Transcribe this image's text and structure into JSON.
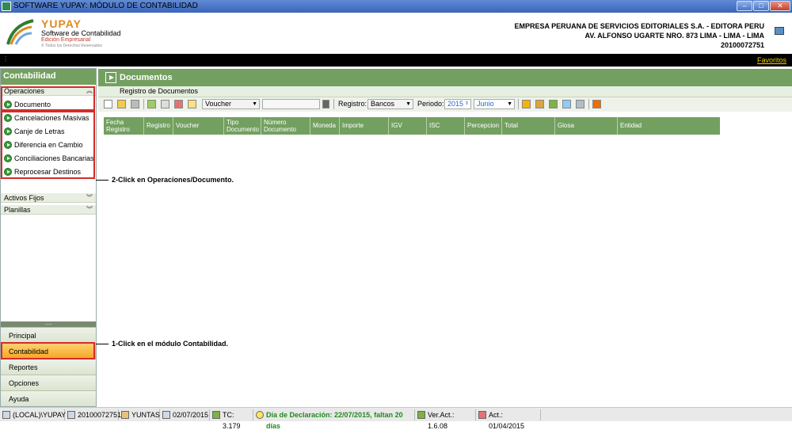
{
  "window": {
    "title": "SOFTWARE YUPAY: MÓDULO DE CONTABILIDAD"
  },
  "brand": {
    "name": "YUPAY",
    "subtitle": "Software de Contabilidad",
    "edition": "Edición Empresarial",
    "copyright": "© Todos los Derechos Reservados"
  },
  "company": {
    "name": "EMPRESA PERUANA DE SERVICIOS EDITORIALES S.A. - EDITORA PERU",
    "address": "AV. ALFONSO UGARTE NRO. 873 LIMA - LIMA - LIMA",
    "ruc": "20100072751"
  },
  "topbar": {
    "favoritos": "Favoritos"
  },
  "sidebar": {
    "title": "Contabilidad",
    "operaciones": "Operaciones",
    "items": [
      "Documento",
      "Cancelaciones Masivas",
      "Canje de Letras",
      "Diferencia en Cambio",
      "Conciliaciones Bancarias",
      "Reprocesar Destinos"
    ],
    "activos_fijos": "Activos Fijos",
    "planillas": "Planillas",
    "splitter": "....."
  },
  "modules": [
    "Principal",
    "Contabilidad",
    "Reportes",
    "Opciones",
    "Ayuda"
  ],
  "main": {
    "title": "Documentos",
    "subtitle": "Registro de Documentos",
    "toolbar": {
      "voucher": "Voucher",
      "registro_label": "Registro:",
      "registro_value": "Bancos",
      "periodo_label": "Periodo:",
      "year": "2015",
      "month": "Junio"
    },
    "columns": [
      [
        "Fecha",
        "Registro"
      ],
      [
        "Registro"
      ],
      [
        "Voucher"
      ],
      [
        "Tipo",
        "Documento"
      ],
      [
        "Número",
        "Documento"
      ],
      [
        "Moneda"
      ],
      [
        "Importe"
      ],
      [
        "IGV"
      ],
      [
        "ISC"
      ],
      [
        "Percepcion"
      ],
      [
        "Total"
      ],
      [
        "Glosa"
      ],
      [
        "Entidad"
      ]
    ]
  },
  "annotations": {
    "step2": "2-Click en Operaciones/Documento.",
    "step1": "1-Click en el módulo Contabilidad."
  },
  "status": {
    "server": "(LOCAL)\\YUPAY",
    "ruc": "20100072751",
    "user": "YUNTAS",
    "date": "02/07/2015",
    "tc": "TC: 3.179",
    "declaracion": "Día de Declaración: 22/07/2015, faltan 20 días",
    "version": "Ver.Act.: 1.6.08",
    "act": "Act.: 01/04/2015"
  },
  "colors": {
    "green": "#73a060",
    "highlight": "#f5a623",
    "annotation_red": "#d62b2b"
  }
}
